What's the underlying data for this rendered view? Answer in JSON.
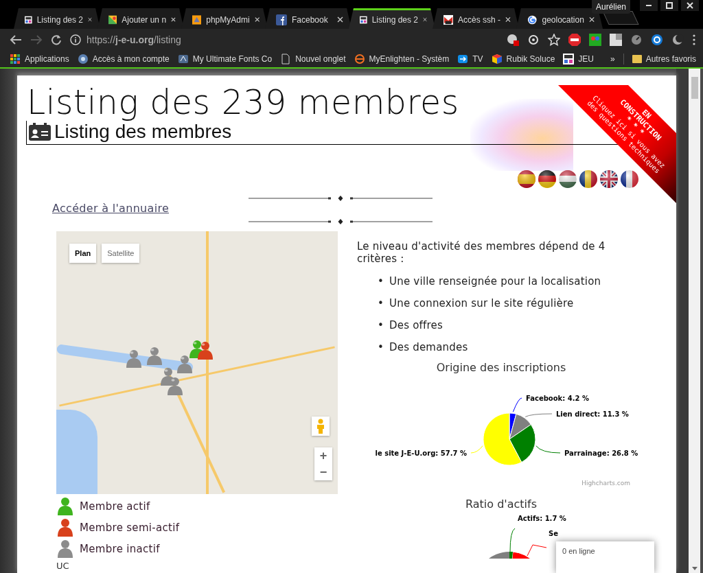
{
  "window": {
    "user_button": "Aurélien"
  },
  "tabs": [
    {
      "title": "Listing des 2",
      "kind": "jeu",
      "selected": false
    },
    {
      "title": "Ajouter un n",
      "kind": "map",
      "selected": false
    },
    {
      "title": "phpMyAdmi",
      "kind": "pma",
      "selected": false
    },
    {
      "title": "Facebook",
      "kind": "facebook",
      "selected": false
    },
    {
      "title": "Listing des 2",
      "kind": "jeu",
      "selected": true
    },
    {
      "title": "Accès ssh - ",
      "kind": "mail",
      "selected": false
    },
    {
      "title": "geolocation",
      "kind": "google",
      "selected": false
    }
  ],
  "address_bar": {
    "url": "https://**j-e-u.org**/listing"
  },
  "bookmarks": [
    {
      "label": "Applications",
      "kind": "apps"
    },
    {
      "label": "Accès à mon compte",
      "kind": "bank"
    },
    {
      "label": "My Ultimate Fonts Co",
      "kind": "fonts"
    },
    {
      "label": "Nouvel onglet",
      "kind": "page"
    },
    {
      "label": "MyEnlighten - Systèm",
      "kind": "enlighten"
    },
    {
      "label": "TV",
      "kind": "tv"
    },
    {
      "label": "Rubik Soluce",
      "kind": "cube"
    },
    {
      "label": "JEU",
      "kind": "jeu"
    }
  ],
  "bookmarks_more": "»",
  "bookmarks_other": "Autres favoris",
  "page": {
    "title": "Listing des 239 membres",
    "subtitle": "Listing des membres",
    "ribbon": [
      "EN",
      "CONSTRUCTION",
      "* * *",
      "Cliquez ici si vous avez",
      "des questions techniques"
    ],
    "languages": [
      {
        "kind": "es"
      },
      {
        "kind": "de"
      },
      {
        "kind": "hu"
      },
      {
        "kind": "ro"
      },
      {
        "kind": "gb"
      },
      {
        "kind": "fr"
      }
    ],
    "directory_link": "Accéder à l'annuaire"
  },
  "map": {
    "map_types": [
      {
        "label": "Plan",
        "selected": true
      },
      {
        "label": "Satellite",
        "selected": false
      }
    ],
    "zoom_in": "+",
    "zoom_out": "−"
  },
  "legend": [
    {
      "label": "Membre actif",
      "color": "#3fb41e"
    },
    {
      "label": "Membre semi-actif",
      "color": "#d8411c"
    },
    {
      "label": "Membre inactif",
      "color": "#8c8c8c"
    }
  ],
  "footer_text": "UC",
  "criteria": {
    "bullet": "•",
    "intro": "Le niveau d'activité des membres dépend de 4 critères :",
    "items": [
      "Une ville renseignée pour la localisation",
      "Une connexion sur le site régulière",
      "Des offres",
      "Des demandes"
    ]
  },
  "origin_chart": {
    "chart_data": {
      "type": "pie",
      "title": "Origine des inscriptions",
      "series": [
        {
          "values": [
            4.2,
            11.3,
            26.8,
            57.7
          ]
        }
      ],
      "colors": [
        "#0000ff",
        "#808080",
        "#008000",
        "#ffff00"
      ],
      "value_labels": [
        "Facebook: 4.2 %",
        "Lien direct: 11.3 %",
        "Parrainage: 26.8 %",
        "le site J-E-U.org: 57.7 %"
      ]
    },
    "credit": "Highcharts.com"
  },
  "ratio_chart": {
    "title": "Ratio d'actifs",
    "labels": [
      "Actifs: 1.7 %",
      "Se"
    ]
  },
  "online_popup": {
    "text": "0 en ligne"
  }
}
